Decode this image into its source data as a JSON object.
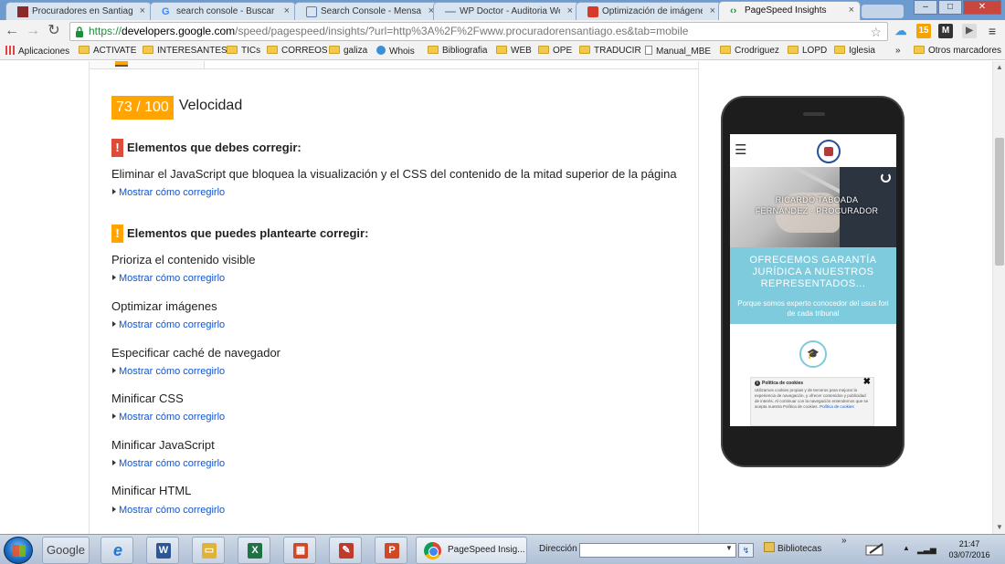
{
  "browser": {
    "tabs": [
      {
        "title": "Procuradores en Santiago",
        "favicon_color": "#8b2a2a",
        "active": false
      },
      {
        "title": "search console - Buscar con",
        "favicon_color": "#4285f4",
        "active": false
      },
      {
        "title": "Search Console - Mensaje",
        "favicon_color": "#5a7fb0",
        "active": false
      },
      {
        "title": "WP Doctor - Auditoria Web",
        "favicon_color": "#9aa8b8",
        "active": false
      },
      {
        "title": "Optimización de imágenes",
        "favicon_color": "#d53a2a",
        "active": false
      },
      {
        "title": "PageSpeed Insights",
        "favicon_color": "#1e8e3e",
        "active": true
      }
    ],
    "url": {
      "scheme": "https://",
      "domain": "developers.google.com",
      "path": "/speed/pagespeed/insights/?url=http%3A%2F%2Fwww.procuradorensantiago.es&tab=mobile"
    },
    "window_buttons": {
      "minimize": "–",
      "maximize": "□",
      "close": "✕"
    },
    "extensions": [
      {
        "name": "cloud-extension",
        "color": "#3b9ae1",
        "label": "☁"
      },
      {
        "name": "calendar-extension",
        "color": "#f4a300",
        "label": "15"
      },
      {
        "name": "m-extension",
        "color": "#333333",
        "label": "M"
      },
      {
        "name": "menu-icon",
        "color": "#555555",
        "label": "≡"
      }
    ],
    "bookmarks": [
      {
        "label": "Aplicaciones",
        "kind": "apps"
      },
      {
        "label": "ACTIVATE",
        "kind": "folder"
      },
      {
        "label": "INTERESANTES",
        "kind": "folder"
      },
      {
        "label": "TICs",
        "kind": "folder"
      },
      {
        "label": "CORREOS",
        "kind": "folder"
      },
      {
        "label": "galiza",
        "kind": "folder"
      },
      {
        "label": "Whois",
        "kind": "site"
      },
      {
        "label": "Bibliografia",
        "kind": "folder"
      },
      {
        "label": "WEB",
        "kind": "folder"
      },
      {
        "label": "OPE",
        "kind": "folder"
      },
      {
        "label": "TRADUCIR",
        "kind": "folder"
      },
      {
        "label": "Manual_MBE",
        "kind": "page"
      },
      {
        "label": "Crodriguez",
        "kind": "folder"
      },
      {
        "label": "LOPD",
        "kind": "folder"
      },
      {
        "label": "Iglesia",
        "kind": "folder"
      },
      {
        "label": "»",
        "kind": "chevron"
      },
      {
        "label": "Otros marcadores",
        "kind": "folder"
      }
    ]
  },
  "report": {
    "score": "73 / 100",
    "score_label": "Velocidad",
    "score_color": "#ffa400",
    "must_fix": {
      "heading": "Elementos que debes corregir:",
      "mark": "!",
      "color": "#dd4b39",
      "rules": [
        {
          "title": "Eliminar el JavaScript que bloquea la visualización y el CSS del contenido de la mitad superior de la página",
          "link": "Mostrar cómo corregirlo"
        }
      ]
    },
    "consider_fix": {
      "heading": "Elementos que puedes plantearte corregir:",
      "mark": "!",
      "color": "#ffa400",
      "rules": [
        {
          "title": "Prioriza el contenido visible",
          "link": "Mostrar cómo corregirlo"
        },
        {
          "title": "Optimizar imágenes",
          "link": "Mostrar cómo corregirlo"
        },
        {
          "title": "Especificar caché de navegador",
          "link": "Mostrar cómo corregirlo"
        },
        {
          "title": "Minificar CSS",
          "link": "Mostrar cómo corregirlo"
        },
        {
          "title": "Minificar JavaScript",
          "link": "Mostrar cómo corregirlo"
        },
        {
          "title": "Minificar HTML",
          "link": "Mostrar cómo corregirlo"
        }
      ]
    }
  },
  "phone_preview": {
    "hero_text": "RICARDO TABOADA FERNÁNDEZ · PROCURADOR",
    "promo_title": "OFRECEMOS GARANTÍA JURÍDICA A NUESTROS REPRESENTADOS...",
    "promo_subtitle": "Porque somos experto conocedor del usus fori de cada tribunal",
    "promo_color": "#7dcbdc",
    "cookie_title": "Política de cookies",
    "cookie_body": "Utilizamos cookies propias y de terceros para mejorar la experiencia de navegación, y ofrecer contenidos y publicidad de interés. Al continuar con la navegación entendemos que se acepta nuestra Política de cookies.",
    "cookie_link": "Política de cookies",
    "cookie_close": "✖"
  },
  "taskbar": {
    "google_label": "Google",
    "apps": [
      {
        "name": "internet-explorer-icon",
        "color": "#1e78d2",
        "label": "e"
      },
      {
        "name": "word-icon",
        "color": "#2b5797",
        "label": "W"
      },
      {
        "name": "explorer-icon",
        "color": "#e0b23a",
        "label": "▭"
      },
      {
        "name": "excel-icon",
        "color": "#1f7244",
        "label": "X"
      },
      {
        "name": "apps-grid-icon",
        "color": "#d24726",
        "label": "▦"
      },
      {
        "name": "drawing-icon",
        "color": "#c0392b",
        "label": "✎"
      },
      {
        "name": "powerpoint-icon",
        "color": "#d24726",
        "label": "P"
      }
    ],
    "active_window": "PageSpeed Insig...",
    "address_label": "Dirección",
    "address_go": "↯",
    "libraries_label": "Bibliotecas",
    "chevron": "»",
    "time": "21:47",
    "date": "03/07/2016"
  }
}
